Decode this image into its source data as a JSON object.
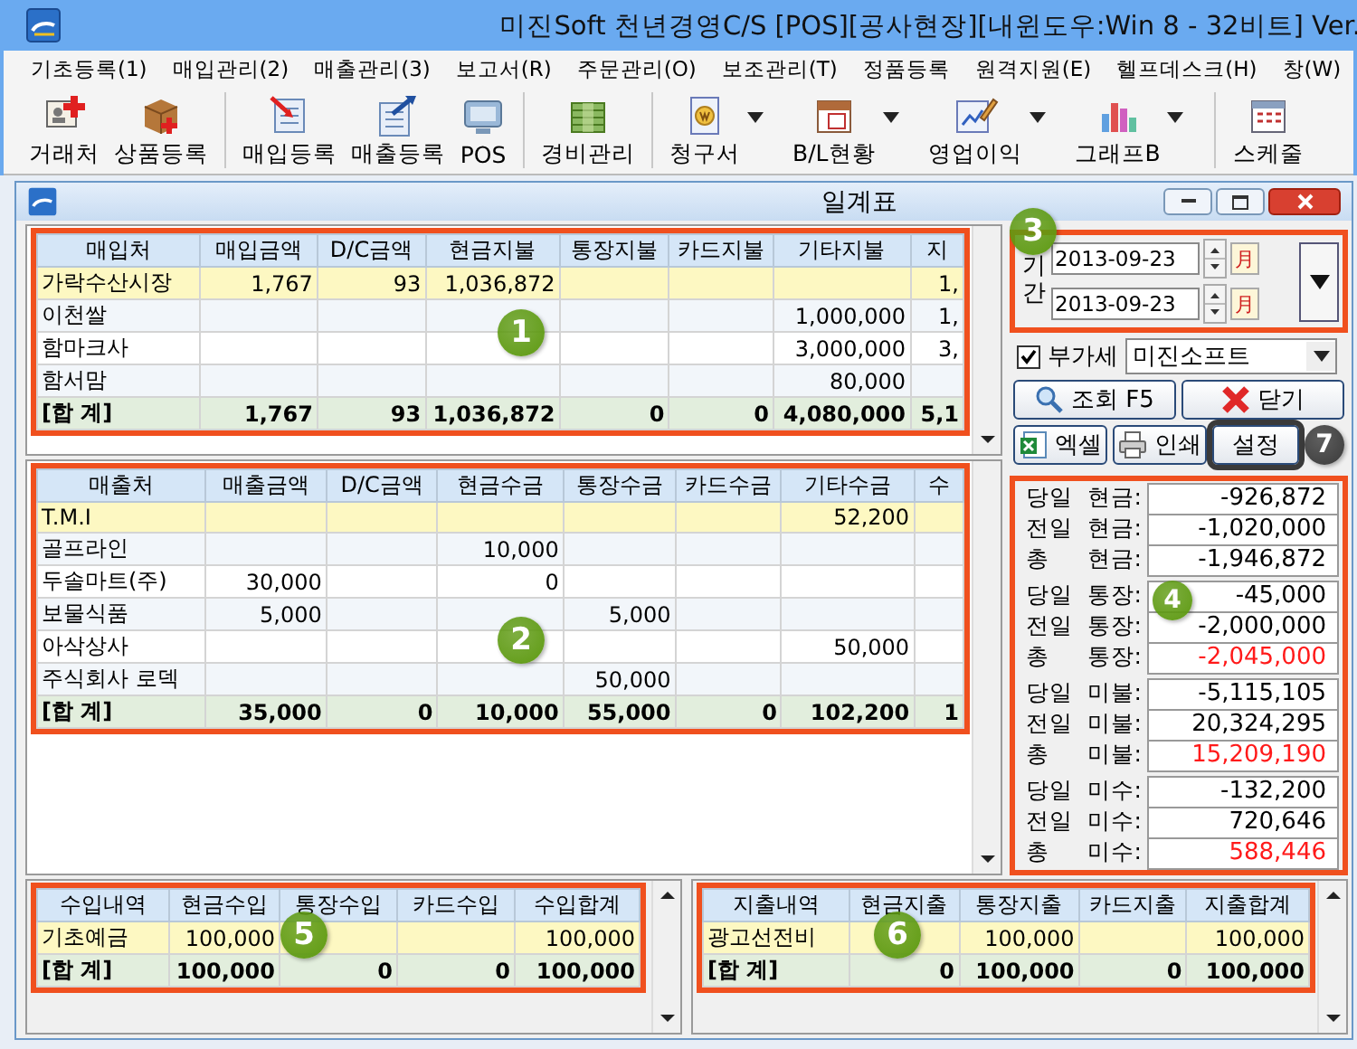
{
  "window": {
    "title": "미진Soft 천년경영C/S [POS][공사현장][내윈도우:Win 8 - 32비트] Ver."
  },
  "menu": [
    "기초등록(1)",
    "매입관리(2)",
    "매출관리(3)",
    "보고서(R)",
    "주문관리(O)",
    "보조관리(T)",
    "정품등록",
    "원격지원(E)",
    "헬프데스크(H)",
    "창(W)"
  ],
  "toolbar": [
    {
      "label": "거래처",
      "has_menu": false,
      "group_end": false
    },
    {
      "label": "상품등록",
      "has_menu": false,
      "group_end": true
    },
    {
      "label": "매입등록",
      "has_menu": false,
      "group_end": false
    },
    {
      "label": "매출등록",
      "has_menu": false,
      "group_end": false
    },
    {
      "label": "POS",
      "has_menu": false,
      "group_end": true
    },
    {
      "label": "경비관리",
      "has_menu": false,
      "group_end": true
    },
    {
      "label": "청구서",
      "has_menu": true,
      "group_end": false
    },
    {
      "label": "B/L현황",
      "has_menu": true,
      "group_end": false
    },
    {
      "label": "영업이익",
      "has_menu": true,
      "group_end": false
    },
    {
      "label": "그래프B",
      "has_menu": true,
      "group_end": true
    },
    {
      "label": "스케줄",
      "has_menu": false,
      "group_end": false
    }
  ],
  "child_window": {
    "title": "일계표"
  },
  "purchase_grid": {
    "columns": [
      "매입처",
      "매입금액",
      "D/C금액",
      "현금지불",
      "통장지불",
      "카드지불",
      "기타지불",
      "지"
    ],
    "rows": [
      {
        "cells": [
          "가락수산시장",
          "1,767",
          "93",
          "1,036,872",
          null,
          null,
          null,
          "1,"
        ],
        "selected": true
      },
      {
        "cells": [
          "이천쌀",
          null,
          null,
          null,
          null,
          null,
          "1,000,000",
          "1,"
        ],
        "selected": false
      },
      {
        "cells": [
          "함마크사",
          null,
          null,
          null,
          null,
          null,
          "3,000,000",
          "3,"
        ],
        "selected": false
      },
      {
        "cells": [
          "함서맘",
          null,
          null,
          null,
          null,
          null,
          "80,000",
          null
        ],
        "selected": false
      }
    ],
    "total": [
      "[합 계]",
      "1,767",
      "93",
      "1,036,872",
      "0",
      "0",
      "4,080,000",
      "5,1"
    ]
  },
  "sales_grid": {
    "columns": [
      "매출처",
      "매출금액",
      "D/C금액",
      "현금수금",
      "통장수금",
      "카드수금",
      "기타수금",
      "수"
    ],
    "rows": [
      {
        "cells": [
          "T.M.I",
          null,
          null,
          null,
          null,
          null,
          "52,200",
          null
        ],
        "selected": true
      },
      {
        "cells": [
          "골프라인",
          null,
          null,
          "10,000",
          null,
          null,
          null,
          null
        ],
        "selected": false
      },
      {
        "cells": [
          "두솔마트(주)",
          "30,000",
          null,
          "0",
          null,
          null,
          null,
          null
        ],
        "selected": false
      },
      {
        "cells": [
          "보물식품",
          "5,000",
          null,
          null,
          "5,000",
          null,
          null,
          null
        ],
        "selected": false
      },
      {
        "cells": [
          "아삭상사",
          null,
          null,
          null,
          null,
          null,
          "50,000",
          null
        ],
        "selected": false
      },
      {
        "cells": [
          "주식회사 로덱",
          null,
          null,
          null,
          "50,000",
          null,
          null,
          null
        ],
        "selected": false
      }
    ],
    "total": [
      "[합 계]",
      "35,000",
      "0",
      "10,000",
      "55,000",
      "0",
      "102,200",
      "1"
    ]
  },
  "period": {
    "label": "기간",
    "dates": [
      {
        "value": "2013-09-23",
        "calendar_label": "月"
      },
      {
        "value": "2013-09-23",
        "calendar_label": "月"
      }
    ]
  },
  "vat": {
    "label": "부가세",
    "checked": true,
    "company": "미진소프트"
  },
  "buttons": [
    {
      "label": "조회 F5",
      "highlighted": false
    },
    {
      "label": "닫기",
      "highlighted": false
    },
    {
      "label": "엑셀",
      "highlighted": false
    },
    {
      "label": "인쇄",
      "highlighted": false
    },
    {
      "label": "설정",
      "highlighted": true
    }
  ],
  "summary": [
    {
      "label": "당일 현금:",
      "value": "-926,872",
      "alert": false
    },
    {
      "label": "전일 현금:",
      "value": "-1,020,000",
      "alert": false
    },
    {
      "label": "총 현금:",
      "value": "-1,946,872",
      "alert": false
    },
    {
      "label": "당일 통장:",
      "value": "-45,000",
      "alert": false
    },
    {
      "label": "전일 통장:",
      "value": "-2,000,000",
      "alert": false
    },
    {
      "label": "총 통장:",
      "value": "-2,045,000",
      "alert": true
    },
    {
      "label": "당일 미불:",
      "value": "-5,115,105",
      "alert": false
    },
    {
      "label": "전일 미불:",
      "value": "20,324,295",
      "alert": false
    },
    {
      "label": "총 미불:",
      "value": "15,209,190",
      "alert": true
    },
    {
      "label": "당일 미수:",
      "value": "-132,200",
      "alert": false
    },
    {
      "label": "전일 미수:",
      "value": "720,646",
      "alert": false
    },
    {
      "label": "총 미수:",
      "value": "588,446",
      "alert": true
    }
  ],
  "income_grid": {
    "columns": [
      "수입내역",
      "현금수입",
      "통장수입",
      "카드수입",
      "수입합계"
    ],
    "rows": [
      {
        "cells": [
          "기초예금",
          "100,000",
          null,
          null,
          "100,000"
        ],
        "selected": true
      }
    ],
    "total": [
      "[합 계]",
      "100,000",
      "0",
      "0",
      "100,000"
    ]
  },
  "expense_grid": {
    "columns": [
      "지출내역",
      "현금지출",
      "통장지출",
      "카드지출",
      "지출합계"
    ],
    "rows": [
      {
        "cells": [
          "광고선전비",
          null,
          "100,000",
          null,
          "100,000"
        ],
        "selected": true
      }
    ],
    "total": [
      "[합 계]",
      "0",
      "100,000",
      "0",
      "100,000"
    ]
  },
  "callouts": [
    {
      "text": "1",
      "kind": "green"
    },
    {
      "text": "2",
      "kind": "green"
    },
    {
      "text": "3",
      "kind": "green"
    },
    {
      "text": "4",
      "kind": "green"
    },
    {
      "text": "5",
      "kind": "green"
    },
    {
      "text": "6",
      "kind": "green"
    },
    {
      "text": "7",
      "kind": "dark"
    }
  ]
}
